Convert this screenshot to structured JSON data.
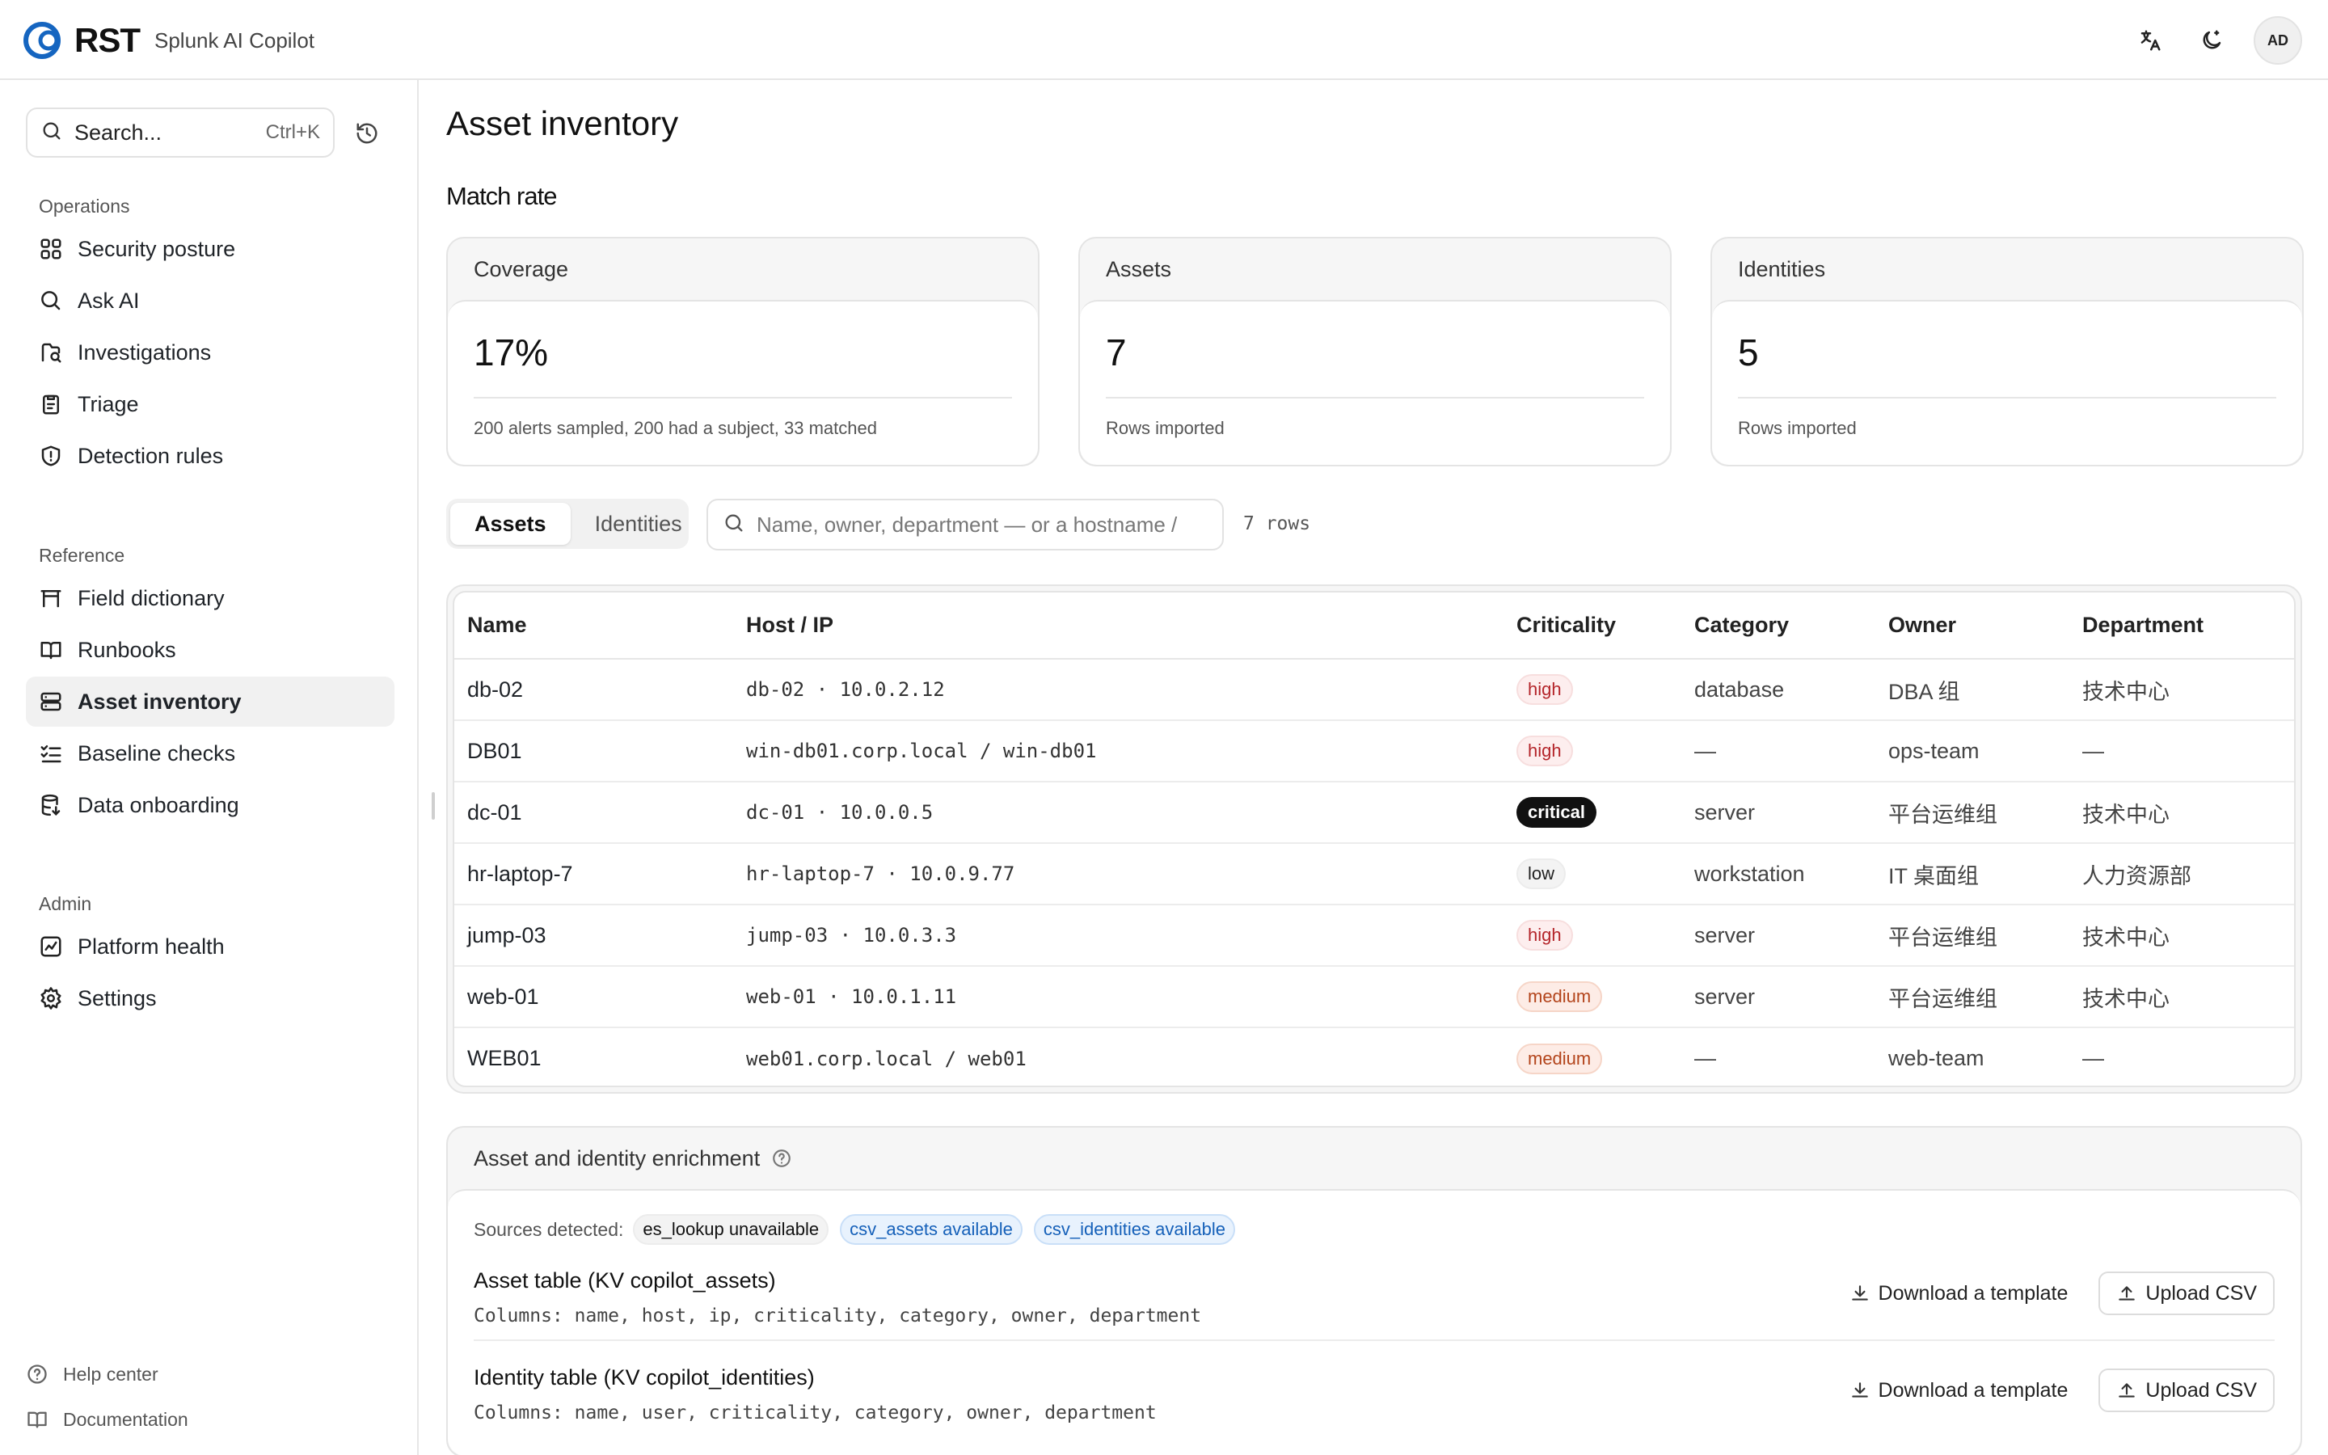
{
  "app": {
    "logo_text": "RST",
    "subtitle": "Splunk AI Copilot",
    "avatar_initials": "AD",
    "brand_color": "#1565c0"
  },
  "topbar_icons": [
    "translate-icon",
    "theme-toggle-icon"
  ],
  "sidebar": {
    "search_placeholder": "Search...",
    "search_shortcut": "Ctrl+K",
    "sections": [
      {
        "heading": "Operations",
        "items": [
          {
            "label": "Security posture",
            "icon": "grid-icon"
          },
          {
            "label": "Ask AI",
            "icon": "search-icon"
          },
          {
            "label": "Investigations",
            "icon": "investigation-icon"
          },
          {
            "label": "Triage",
            "icon": "clipboard-icon"
          },
          {
            "label": "Detection rules",
            "icon": "shield-icon"
          }
        ]
      },
      {
        "heading": "Reference",
        "items": [
          {
            "label": "Field dictionary",
            "icon": "table-icon"
          },
          {
            "label": "Runbooks",
            "icon": "book-icon"
          },
          {
            "label": "Asset inventory",
            "icon": "server-icon",
            "active": true
          },
          {
            "label": "Baseline checks",
            "icon": "checklist-icon"
          },
          {
            "label": "Data onboarding",
            "icon": "database-icon"
          }
        ]
      },
      {
        "heading": "Admin",
        "items": [
          {
            "label": "Platform health",
            "icon": "health-chart-icon"
          },
          {
            "label": "Settings",
            "icon": "gear-icon"
          }
        ]
      }
    ],
    "footer": [
      {
        "label": "Help center",
        "icon": "help-icon"
      },
      {
        "label": "Documentation",
        "icon": "book-icon"
      }
    ]
  },
  "main": {
    "title": "Asset inventory",
    "match_rate": {
      "title": "Match rate",
      "cards": [
        {
          "label": "Coverage",
          "value": "17%",
          "sub": "200 alerts sampled, 200 had a subject, 33 matched"
        },
        {
          "label": "Assets",
          "value": "7",
          "sub": "Rows imported"
        },
        {
          "label": "Identities",
          "value": "5",
          "sub": "Rows imported"
        }
      ]
    },
    "tabs": [
      {
        "label": "Assets",
        "active": true
      },
      {
        "label": "Identities",
        "active": false
      }
    ],
    "filter_placeholder": "Name, owner, department — or a hostname /",
    "row_count": "7 rows",
    "table": {
      "columns": [
        "Name",
        "Host / IP",
        "Criticality",
        "Category",
        "Owner",
        "Department"
      ],
      "rows": [
        {
          "name": "db-02",
          "host": "db-02 · 10.0.2.12",
          "criticality": "high",
          "category": "database",
          "owner": "DBA 组",
          "department": "技术中心"
        },
        {
          "name": "DB01",
          "host": "win-db01.corp.local / win-db01",
          "criticality": "high",
          "category": "—",
          "owner": "ops-team",
          "department": "—"
        },
        {
          "name": "dc-01",
          "host": "dc-01 · 10.0.0.5",
          "criticality": "critical",
          "category": "server",
          "owner": "平台运维组",
          "department": "技术中心"
        },
        {
          "name": "hr-laptop-7",
          "host": "hr-laptop-7 · 10.0.9.77",
          "criticality": "low",
          "category": "workstation",
          "owner": "IT 桌面组",
          "department": "人力资源部"
        },
        {
          "name": "jump-03",
          "host": "jump-03 · 10.0.3.3",
          "criticality": "high",
          "category": "server",
          "owner": "平台运维组",
          "department": "技术中心"
        },
        {
          "name": "web-01",
          "host": "web-01 · 10.0.1.11",
          "criticality": "medium",
          "category": "server",
          "owner": "平台运维组",
          "department": "技术中心"
        },
        {
          "name": "WEB01",
          "host": "web01.corp.local / web01",
          "criticality": "medium",
          "category": "—",
          "owner": "web-team",
          "department": "—"
        }
      ]
    },
    "enrichment": {
      "title": "Asset and identity enrichment",
      "sources_label": "Sources detected:",
      "sources": [
        {
          "label": "es_lookup unavailable",
          "status": "unavailable"
        },
        {
          "label": "csv_assets available",
          "status": "available"
        },
        {
          "label": "csv_identities available",
          "status": "available"
        }
      ],
      "tables": [
        {
          "title": "Asset table (KV copilot_assets)",
          "columns": "Columns: name, host, ip, criticality, category, owner, department",
          "download_label": "Download a template",
          "upload_label": "Upload CSV"
        },
        {
          "title": "Identity table (KV copilot_identities)",
          "columns": "Columns: name, user, criticality, category, owner, department",
          "download_label": "Download a template",
          "upload_label": "Upload CSV"
        }
      ]
    }
  }
}
